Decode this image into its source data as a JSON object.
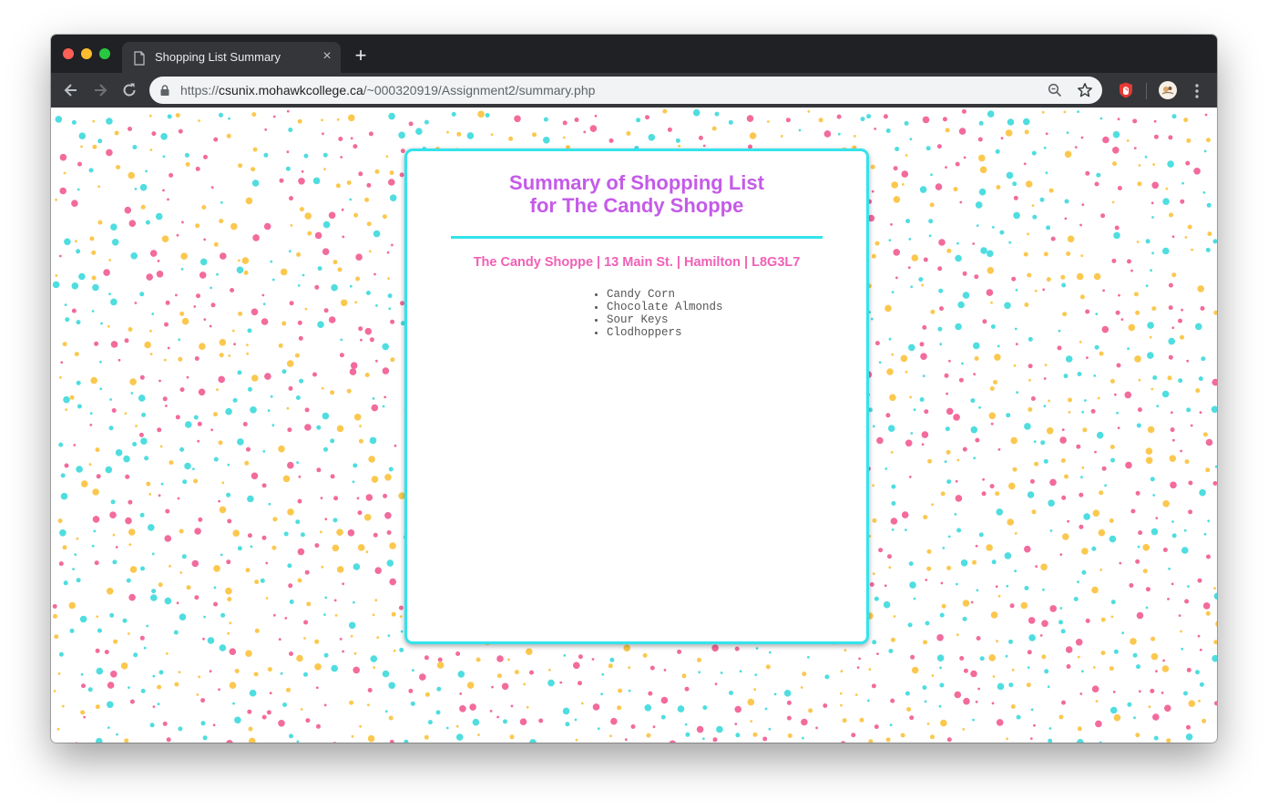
{
  "browser": {
    "tab_title": "Shopping List Summary",
    "tab_close": "×",
    "new_tab": "+",
    "url_scheme": "https://",
    "url_host": "csunix.mohawkcollege.ca",
    "url_path": "/~000320919/Assignment2/summary.php"
  },
  "icons": {
    "tab": "page-icon",
    "back": "arrow-left-icon",
    "forward": "arrow-right-icon",
    "reload": "reload-icon",
    "lock": "lock-icon",
    "zoom": "zoom-icon",
    "bookmark": "star-icon",
    "extension": "extension-icon",
    "profile": "profile-icon",
    "menu": "kebab-menu-icon"
  },
  "page": {
    "heading_line1": "Summary of Shopping List",
    "heading_line2": "for The Candy Shoppe",
    "address": "The Candy Shoppe | 13 Main St. | Hamilton | L8G3L7",
    "items": [
      "Candy Corn",
      "Chocolate Almonds",
      "Sour Keys",
      "Clodhoppers"
    ]
  },
  "colors": {
    "heading": "#c45be8",
    "address": "#f060b5",
    "border": "#33e3ec",
    "confetti": [
      "#f26b9c",
      "#fbc84f",
      "#4fdde0"
    ]
  }
}
